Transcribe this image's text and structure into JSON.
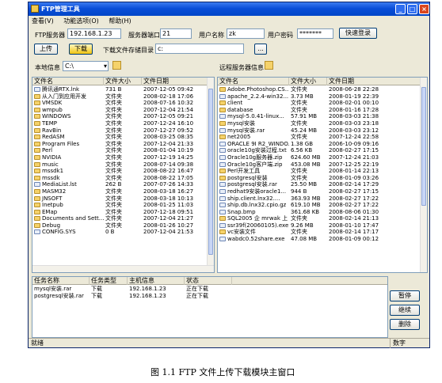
{
  "window": {
    "title": "FTP管理工具",
    "min": "_",
    "max": "□",
    "close": "×"
  },
  "menu": [
    "查看(V)",
    "功能选项(O)",
    "帮助(H)"
  ],
  "connection": {
    "server_label": "FTP服务器",
    "server_value": "192.168.1.23",
    "port_label": "服务器端口",
    "port_value": "21",
    "user_label": "用户名称",
    "user_value": "zk",
    "pass_label": "用户密码",
    "pass_value": "*******",
    "login_button": "快速登录"
  },
  "toolbar": {
    "upload": "上传",
    "download": "下载",
    "dir_label": "下载文件存储目录",
    "dir_value": "c:",
    "browse": "..."
  },
  "local": {
    "label": "本地信息",
    "drive": "C:\\",
    "columns": [
      "文件名",
      "文件大小",
      "文件日期"
    ],
    "rows": [
      [
        "腾讯通RTX.lnk",
        "731 B",
        "2007-12-05 09:42",
        "file"
      ],
      [
        "从入门到应用开发",
        "文件夹",
        "2008-02-18 17:06",
        "folder"
      ],
      [
        "VMSDK",
        "文件夹",
        "2008-07-16 10:32",
        "folder"
      ],
      [
        "wmpub",
        "文件夹",
        "2007-12-04 21:54",
        "folder"
      ],
      [
        "WINDOWS",
        "文件夹",
        "2007-12-05 09:21",
        "folder"
      ],
      [
        "TEMP",
        "文件夹",
        "2007-12-24 16:10",
        "folder"
      ],
      [
        "RavBin",
        "文件夹",
        "2007-12-27 09:52",
        "folder"
      ],
      [
        "RedASM",
        "文件夹",
        "2008-03-25 08:35",
        "folder"
      ],
      [
        "Program Files",
        "文件夹",
        "2007-12-04 21:33",
        "folder"
      ],
      [
        "Perl",
        "文件夹",
        "2008-01-04 10:19",
        "folder"
      ],
      [
        "NVIDIA",
        "文件夹",
        "2007-12-19 14:25",
        "folder"
      ],
      [
        "music",
        "文件夹",
        "2008-07-14 09:38",
        "folder"
      ],
      [
        "mssdk1",
        "文件夹",
        "2008-08-22 16:47",
        "folder"
      ],
      [
        "mssdk",
        "文件夹",
        "2008-08-22 17:05",
        "folder"
      ],
      [
        "MediaList.lst",
        "262 B",
        "2007-07-26 14:33",
        "file"
      ],
      [
        "MASM32",
        "文件夹",
        "2008-03-18 16:27",
        "folder"
      ],
      [
        "JNSOFT",
        "文件夹",
        "2008-03-18 10:13",
        "folder"
      ],
      [
        "Inetpub",
        "文件夹",
        "2008-01-25 11:03",
        "folder"
      ],
      [
        "EMap",
        "文件夹",
        "2007-12-18 09:51",
        "folder"
      ],
      [
        "Documents and Sett...",
        "文件夹",
        "2007-12-04 21:27",
        "folder"
      ],
      [
        "Debug",
        "文件夹",
        "2008-01-26 10:27",
        "folder"
      ],
      [
        "CONFIG.SYS",
        "0 B",
        "2007-12-04 21:53",
        "file"
      ]
    ]
  },
  "remote": {
    "label": "远程服务器信息",
    "columns": [
      "文件名",
      "文件大小",
      "文件日期"
    ],
    "rows": [
      [
        "Adobe.Photoshop.CS...",
        "文件夹",
        "2008-06-28 22:28",
        "folder"
      ],
      [
        "apache_2.2.4-win32...",
        "3.73 MB",
        "2008-01-19 22:39",
        "file"
      ],
      [
        "client",
        "文件夹",
        "2008-02-01 00:10",
        "folder"
      ],
      [
        "database",
        "文件夹",
        "2008-01-16 17:28",
        "folder"
      ],
      [
        "mysql-5.0.41-linux...",
        "57.91 MB",
        "2008-03-03 21:38",
        "file"
      ],
      [
        "mysql安装",
        "文件夹",
        "2008-03-03 23:18",
        "folder"
      ],
      [
        "mysql安装.rar",
        "45.24 MB",
        "2008-03-03 23:12",
        "file"
      ],
      [
        "net2005",
        "文件夹",
        "2007-12-24 22:58",
        "folder"
      ],
      [
        "ORACLE 9I R2_WINDO...",
        "1.38 GB",
        "2006-10-09 09:16",
        "file"
      ],
      [
        "oracle10g安装过程.txt",
        "6.56 KB",
        "2008-02-27 17:15",
        "file"
      ],
      [
        "Oracle10g服务器.zip",
        "624.60 MB",
        "2007-12-24 21:03",
        "file"
      ],
      [
        "Oracle10g客户端.zip",
        "453.08 MB",
        "2007-12-25 22:19",
        "file"
      ],
      [
        "Perl开发工具",
        "文件夹",
        "2008-01-14 22:13",
        "folder"
      ],
      [
        "postgresql安装",
        "文件夹",
        "2008-01-09 03:26",
        "folder"
      ],
      [
        "postgresql安装.rar",
        "25.50 MB",
        "2008-02-14 17:29",
        "file"
      ],
      [
        "redhat9安装oracle1...",
        "944 B",
        "2008-02-27 17:15",
        "file"
      ],
      [
        "ship.client.lnx32....",
        "363.93 MB",
        "2008-02-27 17:22",
        "file"
      ],
      [
        "ship.db.lnx32.cpio.gz",
        "619.10 MB",
        "2008-02-27 17:22",
        "file"
      ],
      [
        "Snap.bmp",
        "361.68 KB",
        "2008-08-06 01:30",
        "file"
      ],
      [
        "SQL2005 企 mrwak 上",
        "文件夹",
        "2008-02-14 21:13",
        "folder"
      ],
      [
        "ssr39f(20060105).exe",
        "9.26 MB",
        "2008-01-10 17:47",
        "file"
      ],
      [
        "vc安装文件",
        "文件夹",
        "2008-02-14 17:17",
        "folder"
      ],
      [
        "wabdc0.52share.exe",
        "47.08 MB",
        "2008-01-09 00:12",
        "file"
      ]
    ]
  },
  "tasks": {
    "columns": [
      "任务名称",
      "任务类型",
      "主机信息",
      "状态"
    ],
    "rows": [
      [
        "mysql安装.rar",
        "下载",
        "192.168.1.23",
        "正在下载"
      ],
      [
        "postgresql安装.rar",
        "下载",
        "192.168.1.23",
        "正在下载"
      ]
    ],
    "pause": "暂停",
    "resume": "继续",
    "delete": "删除"
  },
  "statusbar": {
    "left": "就绪",
    "right": "数字"
  },
  "caption": "图 1.1   FTP 文件上传下载模块主窗口"
}
